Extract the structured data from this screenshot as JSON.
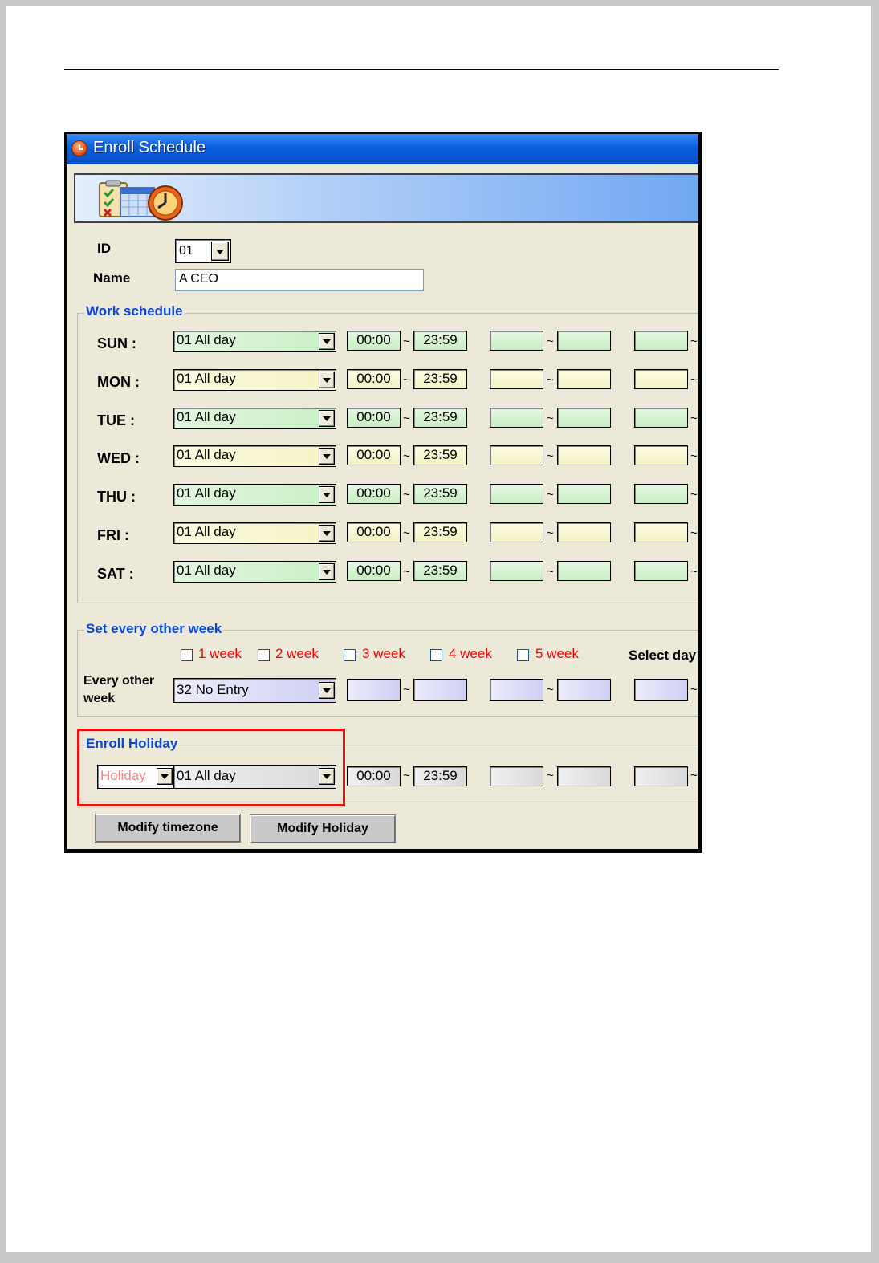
{
  "window": {
    "title": "Enroll Schedule"
  },
  "form": {
    "id_label": "ID",
    "id_value": "01",
    "name_label": "Name",
    "name_value": "A CEO"
  },
  "work_schedule": {
    "legend": "Work schedule",
    "tilde": "~",
    "days": [
      {
        "label": "SUN :",
        "zone": "01 All day",
        "start": "00:00",
        "end": "23:59",
        "color": "green"
      },
      {
        "label": "MON :",
        "zone": "01 All day",
        "start": "00:00",
        "end": "23:59",
        "color": "yellow"
      },
      {
        "label": "TUE :",
        "zone": "01 All day",
        "start": "00:00",
        "end": "23:59",
        "color": "green"
      },
      {
        "label": "WED :",
        "zone": "01 All day",
        "start": "00:00",
        "end": "23:59",
        "color": "yellow"
      },
      {
        "label": "THU :",
        "zone": "01 All day",
        "start": "00:00",
        "end": "23:59",
        "color": "green"
      },
      {
        "label": "FRI :",
        "zone": "01 All day",
        "start": "00:00",
        "end": "23:59",
        "color": "yellow"
      },
      {
        "label": "SAT :",
        "zone": "01 All day",
        "start": "00:00",
        "end": "23:59",
        "color": "green"
      }
    ]
  },
  "every_other_week": {
    "legend": "Set every other week",
    "weeks": [
      "1 week",
      "2 week",
      "3 week",
      "4 week",
      "5 week"
    ],
    "select_day_label": "Select day",
    "row_label_line1": "Every other",
    "row_label_line2": "week",
    "zone": "32 No Entry"
  },
  "holiday": {
    "legend": "Enroll Holiday",
    "type": "Holiday",
    "zone": "01 All day",
    "start": "00:00",
    "end": "23:59"
  },
  "buttons": {
    "modify_timezone": "Modify timezone",
    "modify_holiday": "Modify Holiday"
  },
  "colors": {
    "title_bar": "#0a5ddc",
    "legend_text": "#0a46d8",
    "week_text": "#ff0000",
    "highlight_border": "#ee1111",
    "holiday_type_text": "#ff8080"
  }
}
